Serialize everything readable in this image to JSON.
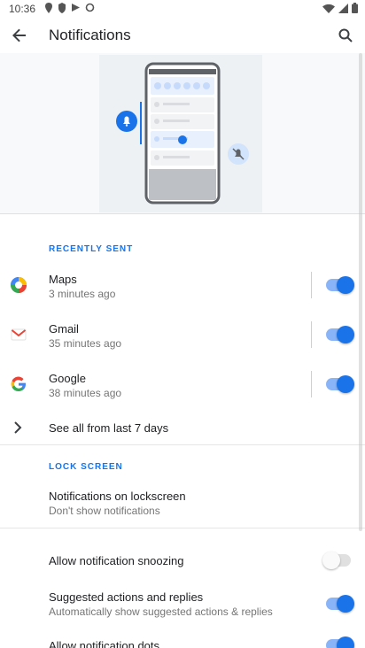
{
  "status_bar": {
    "time": "10:36"
  },
  "app_bar": {
    "title": "Notifications"
  },
  "recently_sent": {
    "header": "RECENTLY SENT",
    "apps": [
      {
        "name": "Maps",
        "time": "3 minutes ago",
        "enabled": true,
        "icon": "maps-icon"
      },
      {
        "name": "Gmail",
        "time": "35 minutes ago",
        "enabled": true,
        "icon": "gmail-icon"
      },
      {
        "name": "Google",
        "time": "38 minutes ago",
        "enabled": true,
        "icon": "google-icon"
      }
    ],
    "see_all": "See all from last 7 days"
  },
  "lock_screen": {
    "header": "LOCK SCREEN",
    "title": "Notifications on lockscreen",
    "summary": "Don't show notifications"
  },
  "settings": {
    "snoozing": {
      "label": "Allow notification snoozing",
      "enabled": false
    },
    "suggested": {
      "label": "Suggested actions and replies",
      "summary": "Automatically show suggested actions & replies",
      "enabled": true
    },
    "dots": {
      "label": "Allow notification dots",
      "enabled": true
    }
  },
  "colors": {
    "accent": "#1a73e8",
    "track_on": "#8ab4f8",
    "track_off": "#e0e0e0"
  }
}
